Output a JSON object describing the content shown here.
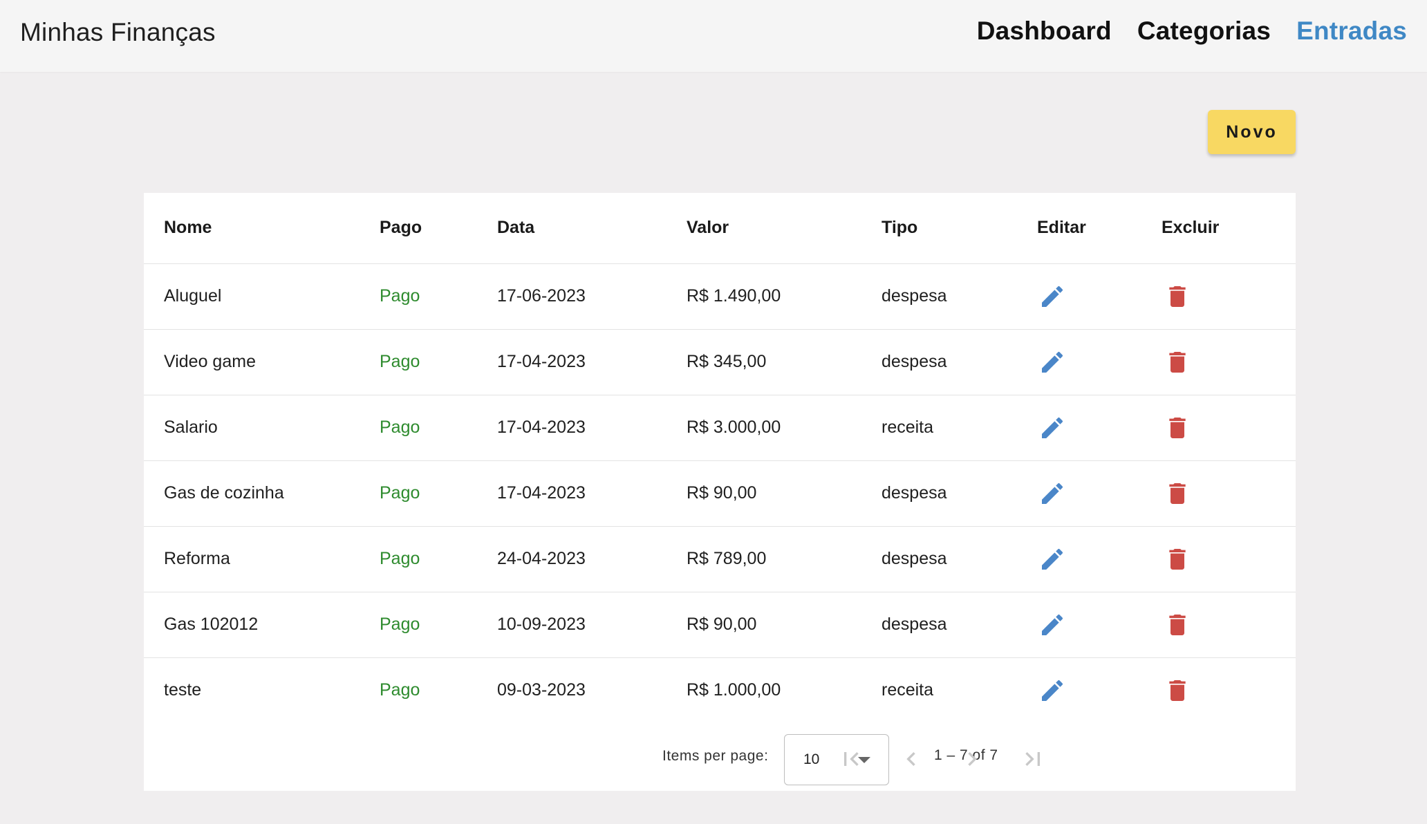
{
  "app": {
    "title": "Minhas Finanças"
  },
  "nav": {
    "items": [
      {
        "label": "Dashboard",
        "active": false
      },
      {
        "label": "Categorias",
        "active": false
      },
      {
        "label": "Entradas",
        "active": true
      }
    ]
  },
  "actions": {
    "novo_label": "Novo"
  },
  "table": {
    "headers": {
      "nome": "Nome",
      "pago": "Pago",
      "data": "Data",
      "valor": "Valor",
      "tipo": "Tipo",
      "editar": "Editar",
      "excluir": "Excluir"
    },
    "rows": [
      {
        "nome": "Aluguel",
        "pago": "Pago",
        "data": "17-06-2023",
        "valor": "R$ 1.490,00",
        "tipo": "despesa"
      },
      {
        "nome": "Video game",
        "pago": "Pago",
        "data": "17-04-2023",
        "valor": "R$ 345,00",
        "tipo": "despesa"
      },
      {
        "nome": "Salario",
        "pago": "Pago",
        "data": "17-04-2023",
        "valor": "R$ 3.000,00",
        "tipo": "receita"
      },
      {
        "nome": "Gas de cozinha",
        "pago": "Pago",
        "data": "17-04-2023",
        "valor": "R$ 90,00",
        "tipo": "despesa"
      },
      {
        "nome": "Reforma",
        "pago": "Pago",
        "data": "24-04-2023",
        "valor": "R$ 789,00",
        "tipo": "despesa"
      },
      {
        "nome": "Gas 102012",
        "pago": "Pago",
        "data": "10-09-2023",
        "valor": "R$ 90,00",
        "tipo": "despesa"
      },
      {
        "nome": "teste",
        "pago": "Pago",
        "data": "09-03-2023",
        "valor": "R$ 1.000,00",
        "tipo": "receita"
      }
    ],
    "row_icons": {
      "edit": "pencil-icon",
      "delete": "trash-icon"
    }
  },
  "paginator": {
    "items_per_page_label": "Items per page:",
    "items_per_page_value": "10",
    "range_label": "1 – 7 of 7",
    "buttons": [
      "first-page-icon",
      "previous-page-icon",
      "next-page-icon",
      "last-page-icon"
    ]
  },
  "colors": {
    "topbar_bg": "#f5f5f5",
    "page_bg": "#f0eeef",
    "active_nav": "#3f88c5",
    "novo_button": "#f8d862",
    "pago_text": "#2e8b2e",
    "edit_icon": "#4a86c8",
    "delete_icon": "#cc4b45",
    "paginator_disabled": "#c8c8c8"
  }
}
